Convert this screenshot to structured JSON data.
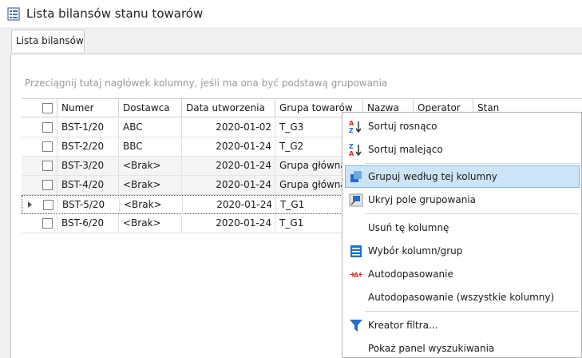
{
  "window": {
    "title": "Lista bilansów stanu towarów"
  },
  "tabs": [
    {
      "label": "Lista bilansów"
    }
  ],
  "grid": {
    "group_hint": "Przeciągnij tutaj nagłówek kolumny, jeśli ma ona być podstawą grupowania",
    "columns": [
      "Numer",
      "Dostawca",
      "Data utworzenia",
      "Grupa towarów",
      "Nazwa",
      "Operator",
      "Stan"
    ],
    "rows": [
      {
        "numer": "BST-1/20",
        "dostawca": "ABC",
        "data": "2020-01-02",
        "grupa": "T_G3"
      },
      {
        "numer": "BST-2/20",
        "dostawca": "BBC",
        "data": "2020-01-24",
        "grupa": "T_G2"
      },
      {
        "numer": "BST-3/20",
        "dostawca": "<Brak>",
        "data": "2020-01-24",
        "grupa": "Grupa główna"
      },
      {
        "numer": "BST-4/20",
        "dostawca": "<Brak>",
        "data": "2020-01-24",
        "grupa": "Grupa główna"
      },
      {
        "numer": "BST-5/20",
        "dostawca": "<Brak>",
        "data": "2020-01-24",
        "grupa": "T_G1"
      },
      {
        "numer": "BST-6/20",
        "dostawca": "<Brak>",
        "data": "2020-01-24",
        "grupa": "T_G1"
      }
    ],
    "current_row": 4
  },
  "context_menu": {
    "items": [
      {
        "label": "Sortuj rosnąco",
        "icon": "sort-ascending-icon"
      },
      {
        "label": "Sortuj malejąco",
        "icon": "sort-descending-icon"
      },
      {
        "label": "Grupuj według tej kolumny",
        "icon": "group-by-column-icon"
      },
      {
        "label": "Ukryj pole grupowania",
        "icon": "hide-group-panel-icon"
      },
      {
        "label": "Usuń tę kolumnę",
        "icon": ""
      },
      {
        "label": "Wybór kolumn/grup",
        "icon": "column-chooser-icon"
      },
      {
        "label": "Autodopasowanie",
        "icon": "autofit-icon"
      },
      {
        "label": "Autodopasowanie (wszystkie kolumny)",
        "icon": ""
      },
      {
        "label": "Kreator filtra...",
        "icon": "filter-icon"
      },
      {
        "label": "Pokaż panel wyszukiwania",
        "icon": ""
      }
    ],
    "highlighted": 2
  },
  "colors": {
    "highlight_bg": "#cde4f7",
    "highlight_border": "#7eb4ea",
    "icon_blue": "#1e6fd0",
    "icon_red": "#d32f2f"
  }
}
